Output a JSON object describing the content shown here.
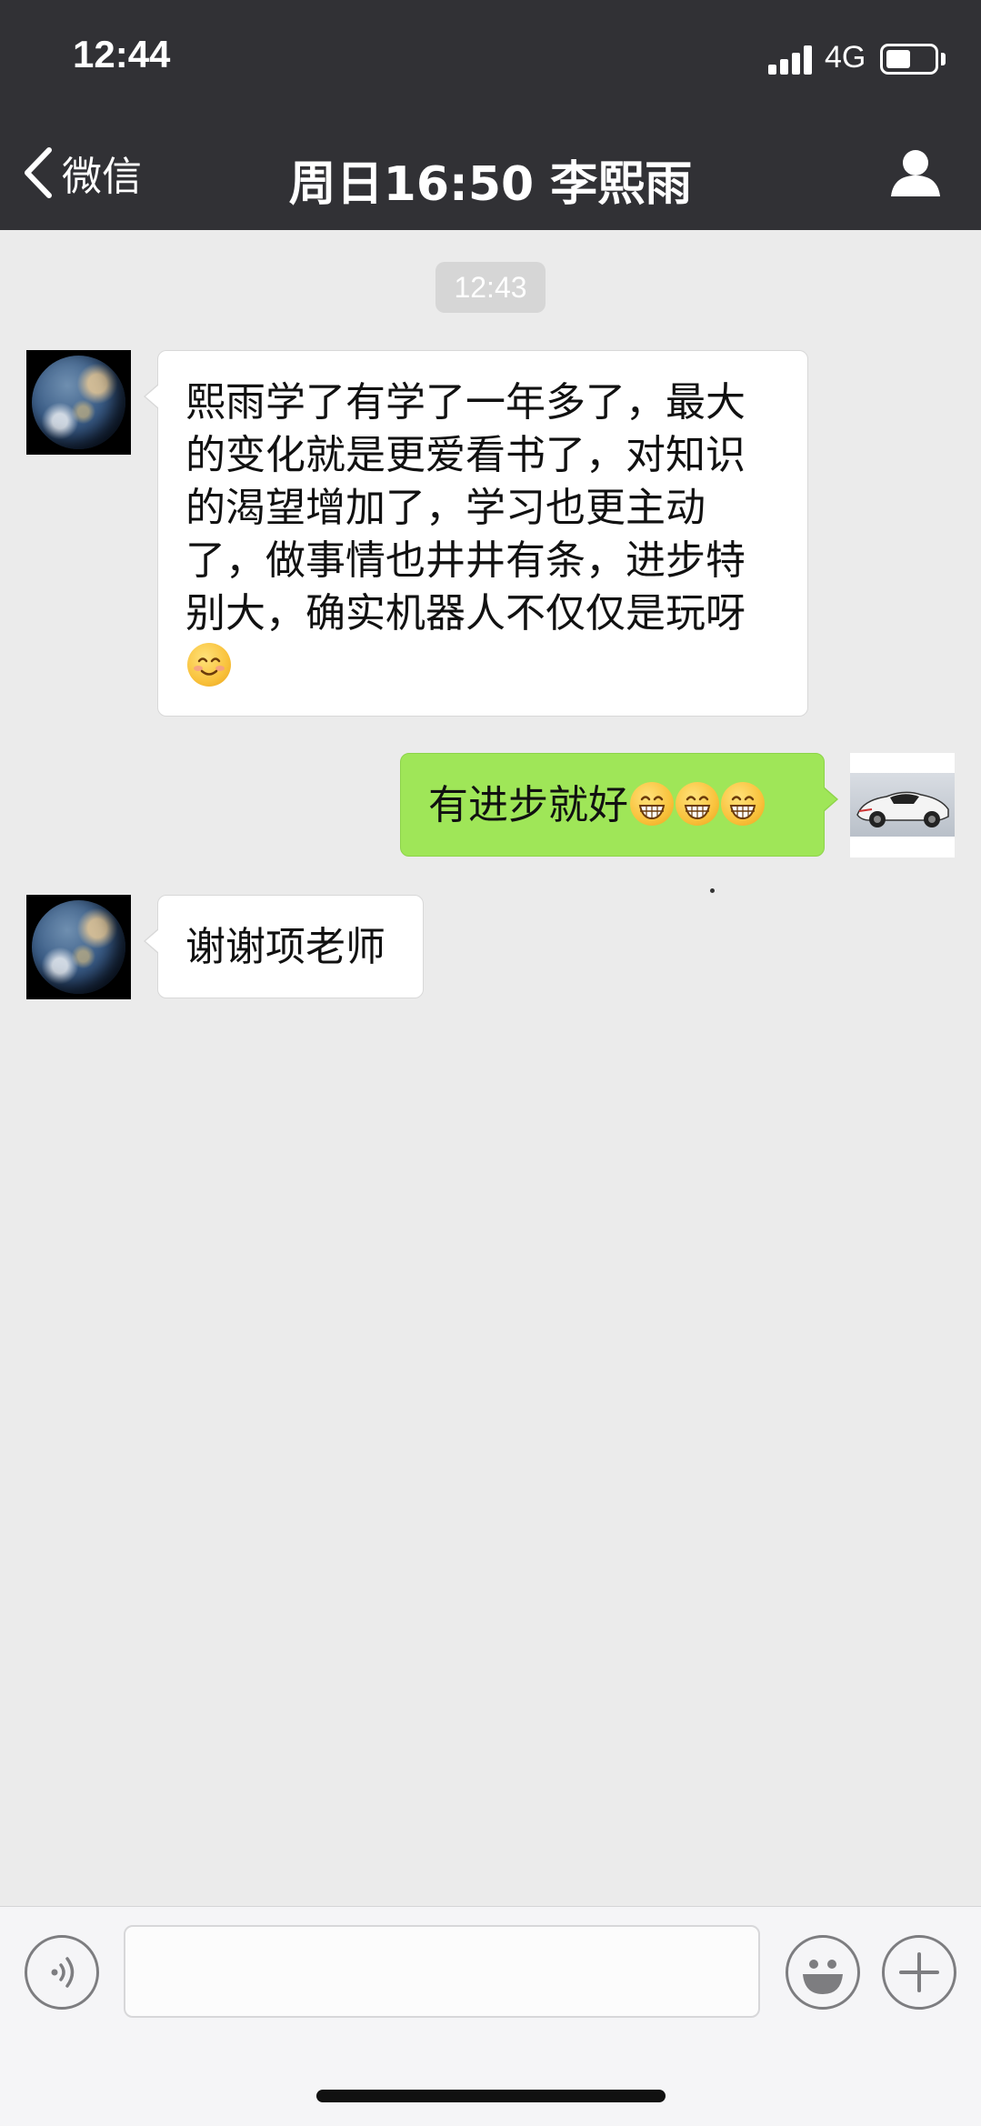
{
  "status_bar": {
    "time": "12:44",
    "network": "4G",
    "signal_bars": 4,
    "battery_level": 0.5
  },
  "nav": {
    "back_label": "微信",
    "title": "周日16:50 李熙雨",
    "icons": {
      "back": "chevron-left-icon",
      "profile": "person-icon"
    }
  },
  "chat": {
    "timestamp": "12:43",
    "messages": [
      {
        "side": "left",
        "avatar": "earth-avatar",
        "lines": [
          "熙雨学了有学了一年多了，最大",
          "的变化就是更爱看书了，对知识",
          "的渴望增加了，学习也更主动",
          "了，做事情也井井有条，进步特",
          "别大，确实机器人不仅仅是玩呀"
        ],
        "emojis": [
          "smile-emoji"
        ]
      },
      {
        "side": "right",
        "avatar": "car-avatar",
        "text": "有进步就好",
        "emojis": [
          "grin-emoji",
          "grin-emoji",
          "grin-emoji"
        ]
      },
      {
        "side": "left",
        "avatar": "earth-avatar",
        "text": "谢谢项老师"
      }
    ]
  },
  "input_bar": {
    "value": "",
    "icons": {
      "voice": "voice-icon",
      "emoji": "emoji-icon",
      "more": "plus-icon"
    }
  },
  "colors": {
    "nav_bg": "#313135",
    "chat_bg": "#ebebeb",
    "sent_bubble": "#9fe658",
    "received_bubble": "#ffffff",
    "input_bg": "#f5f5f7"
  }
}
